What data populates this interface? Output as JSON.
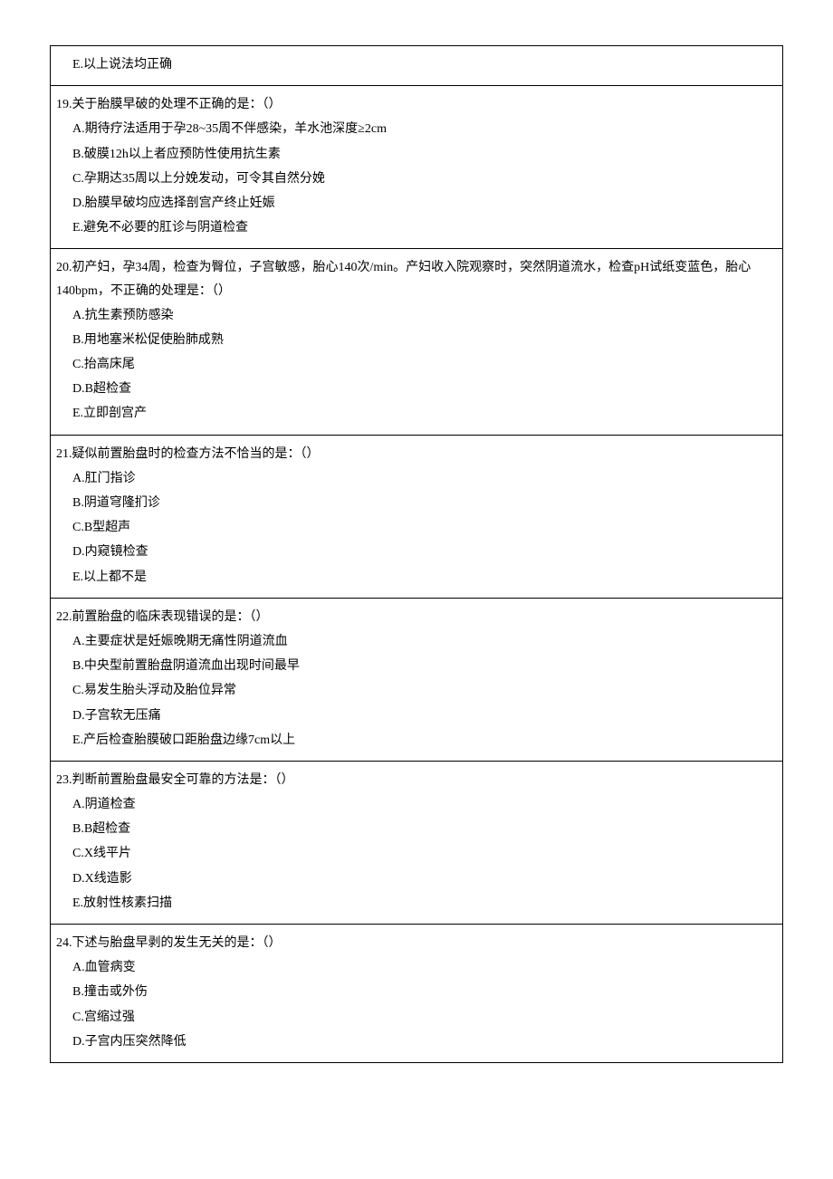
{
  "questions": [
    {
      "id": "q18e",
      "stem": "",
      "options": [
        {
          "label": "E",
          "text": "E.以上说法均正确"
        }
      ],
      "partial": true
    },
    {
      "id": "q19",
      "stem": "19.关于胎膜早破的处理不正确的是：（）",
      "options": [
        {
          "label": "A",
          "text": "A.期待疗法适用于孕28~35周不伴感染，羊水池深度≥2cm"
        },
        {
          "label": "B",
          "text": "B.破膜12h以上者应预防性使用抗生素"
        },
        {
          "label": "C",
          "text": "C.孕期达35周以上分娩发动，可令其自然分娩"
        },
        {
          "label": "D",
          "text": "D.胎膜早破均应选择剖宫产终止妊娠"
        },
        {
          "label": "E",
          "text": "E.避免不必要的肛诊与阴道检查"
        }
      ]
    },
    {
      "id": "q20",
      "stem": "20.初产妇，孕34周，检查为臀位，子宫敏感，胎心140次/min。产妇收入院观察时，突然阴道流水，检查pH试纸变蓝色，胎心140bpm，不正确的处理是：（）",
      "options": [
        {
          "label": "A",
          "text": "A.抗生素预防感染"
        },
        {
          "label": "B",
          "text": "B.用地塞米松促使胎肺成熟"
        },
        {
          "label": "C",
          "text": "C.抬高床尾"
        },
        {
          "label": "D",
          "text": "D.B超检查"
        },
        {
          "label": "E",
          "text": "E.立即剖宫产"
        }
      ]
    },
    {
      "id": "q21",
      "stem": "21.疑似前置胎盘时的检查方法不恰当的是：（）",
      "options": [
        {
          "label": "A",
          "text": "A.肛门指诊"
        },
        {
          "label": "B",
          "text": "B.阴道穹隆扪诊"
        },
        {
          "label": "C",
          "text": "C.B型超声"
        },
        {
          "label": "D",
          "text": "D.内窥镜检查"
        },
        {
          "label": "E",
          "text": "E.以上都不是"
        }
      ]
    },
    {
      "id": "q22",
      "stem": "22.前置胎盘的临床表现错误的是：（）",
      "options": [
        {
          "label": "A",
          "text": "A.主要症状是妊娠晚期无痛性阴道流血"
        },
        {
          "label": "B",
          "text": "B.中央型前置胎盘阴道流血出现时间最早"
        },
        {
          "label": "C",
          "text": "C.易发生胎头浮动及胎位异常"
        },
        {
          "label": "D",
          "text": "D.子宫软无压痛"
        },
        {
          "label": "E",
          "text": "E.产后检查胎膜破口距胎盘边缘7cm以上"
        }
      ]
    },
    {
      "id": "q23",
      "stem": "23.判断前置胎盘最安全可靠的方法是：（）",
      "options": [
        {
          "label": "A",
          "text": "A.阴道检查"
        },
        {
          "label": "B",
          "text": "B.B超检查"
        },
        {
          "label": "C",
          "text": "C.X线平片"
        },
        {
          "label": "D",
          "text": "D.X线造影"
        },
        {
          "label": "E",
          "text": "E.放射性核素扫描"
        }
      ]
    },
    {
      "id": "q24",
      "stem": "24.下述与胎盘早剥的发生无关的是：（）",
      "options": [
        {
          "label": "A",
          "text": "A.血管病变"
        },
        {
          "label": "B",
          "text": "B.撞击或外伤"
        },
        {
          "label": "C",
          "text": "C.宫缩过强"
        },
        {
          "label": "D",
          "text": "D.子宫内压突然降低"
        }
      ]
    }
  ]
}
